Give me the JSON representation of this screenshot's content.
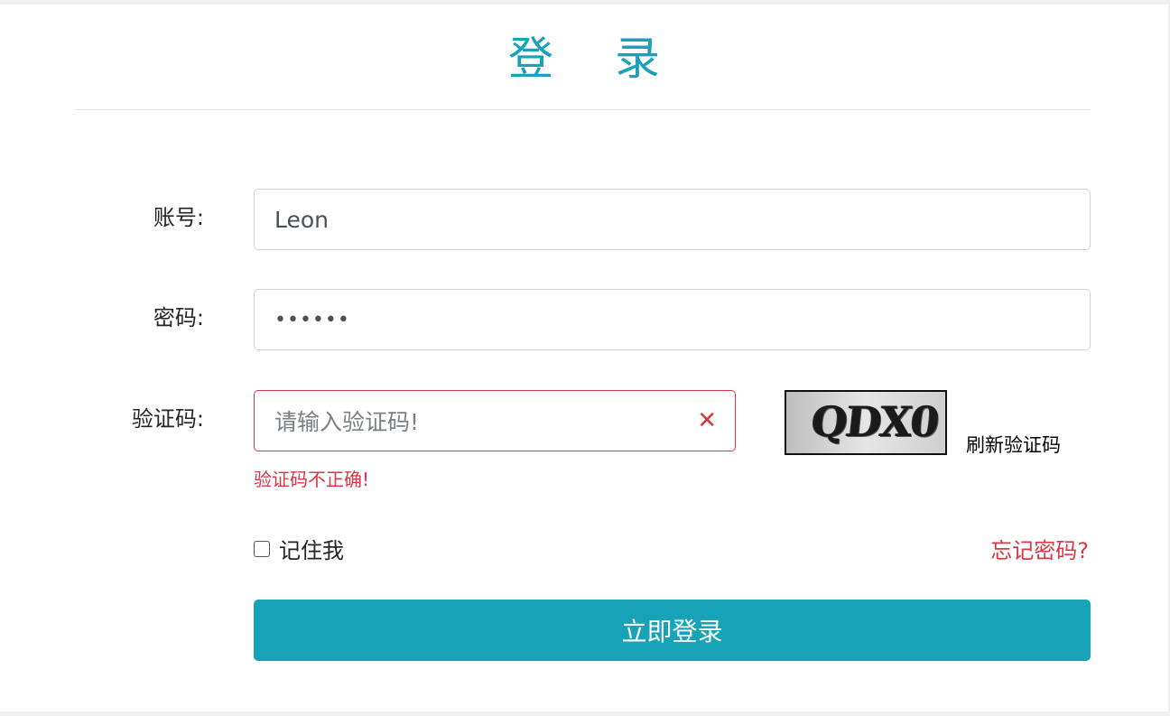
{
  "title": "登 录",
  "form": {
    "account_label": "账号:",
    "account_value": "Leon",
    "password_label": "密码:",
    "password_value": "••••••",
    "captcha_label": "验证码:",
    "captcha_placeholder": "请输入验证码!",
    "captcha_error": "验证码不正确!",
    "captcha_image_text": "QDX0",
    "refresh_label": "刷新验证码",
    "remember_label": "记住我",
    "forgot_label": "忘记密码?",
    "submit_label": "立即登录"
  },
  "icons": {
    "invalid": "close-icon"
  },
  "colors": {
    "accent": "#17a2b8",
    "danger": "#dc3545"
  }
}
